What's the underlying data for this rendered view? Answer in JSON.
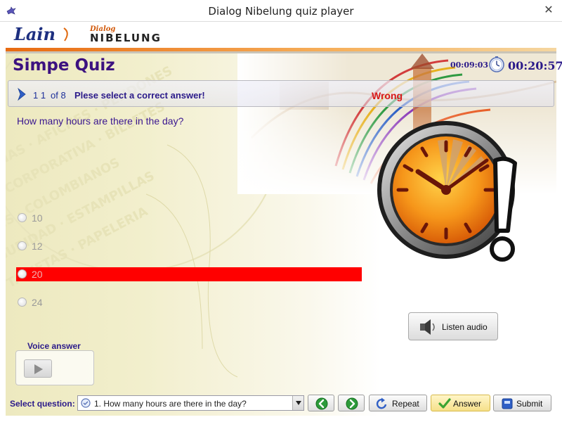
{
  "window": {
    "title": "Dialog Nibelung quiz player",
    "close_glyph": "✕"
  },
  "branding": {
    "lain": "Lain",
    "lain_sub": "LAIN",
    "dialog": "Dialog",
    "nibelung": "NIBELUNG"
  },
  "quiz": {
    "title": "Simpe Quiz",
    "elapsed_time": "00:09:03",
    "remaining_time": "00:20:57",
    "question_index": "1 1",
    "of_total": "of 8",
    "instruction": "Plese select a correct answer!",
    "status": "Wrong",
    "question": "How many hours are there in the day?",
    "options": [
      {
        "label": "10",
        "selected": false
      },
      {
        "label": "12",
        "selected": false
      },
      {
        "label": "20",
        "selected": true
      },
      {
        "label": "24",
        "selected": false
      }
    ]
  },
  "audio": {
    "listen_label": "Listen audio",
    "voice_answer_label": "Voice answer"
  },
  "bottom_bar": {
    "select_label": "Select question:",
    "selected_question": "1. How many hours are there in the day?",
    "repeat_label": "Repeat",
    "answer_label": "Answer",
    "submit_label": "Submit"
  },
  "icons": {
    "app": "app-icon",
    "timer": "stopwatch-icon",
    "nav": "chevron-right-icon",
    "alarm": "alarm-clock-warning-icon",
    "speaker": "speaker-icon",
    "play": "play-icon",
    "prev": "arrow-left-icon",
    "next": "arrow-right-icon",
    "repeat": "repeat-icon",
    "answer": "checkmark-icon",
    "submit": "submit-icon"
  },
  "colors": {
    "title": "#3c1180",
    "accent_orange": "#e86a10",
    "wrong": "#d81818",
    "selected_option": "#ff0000"
  }
}
